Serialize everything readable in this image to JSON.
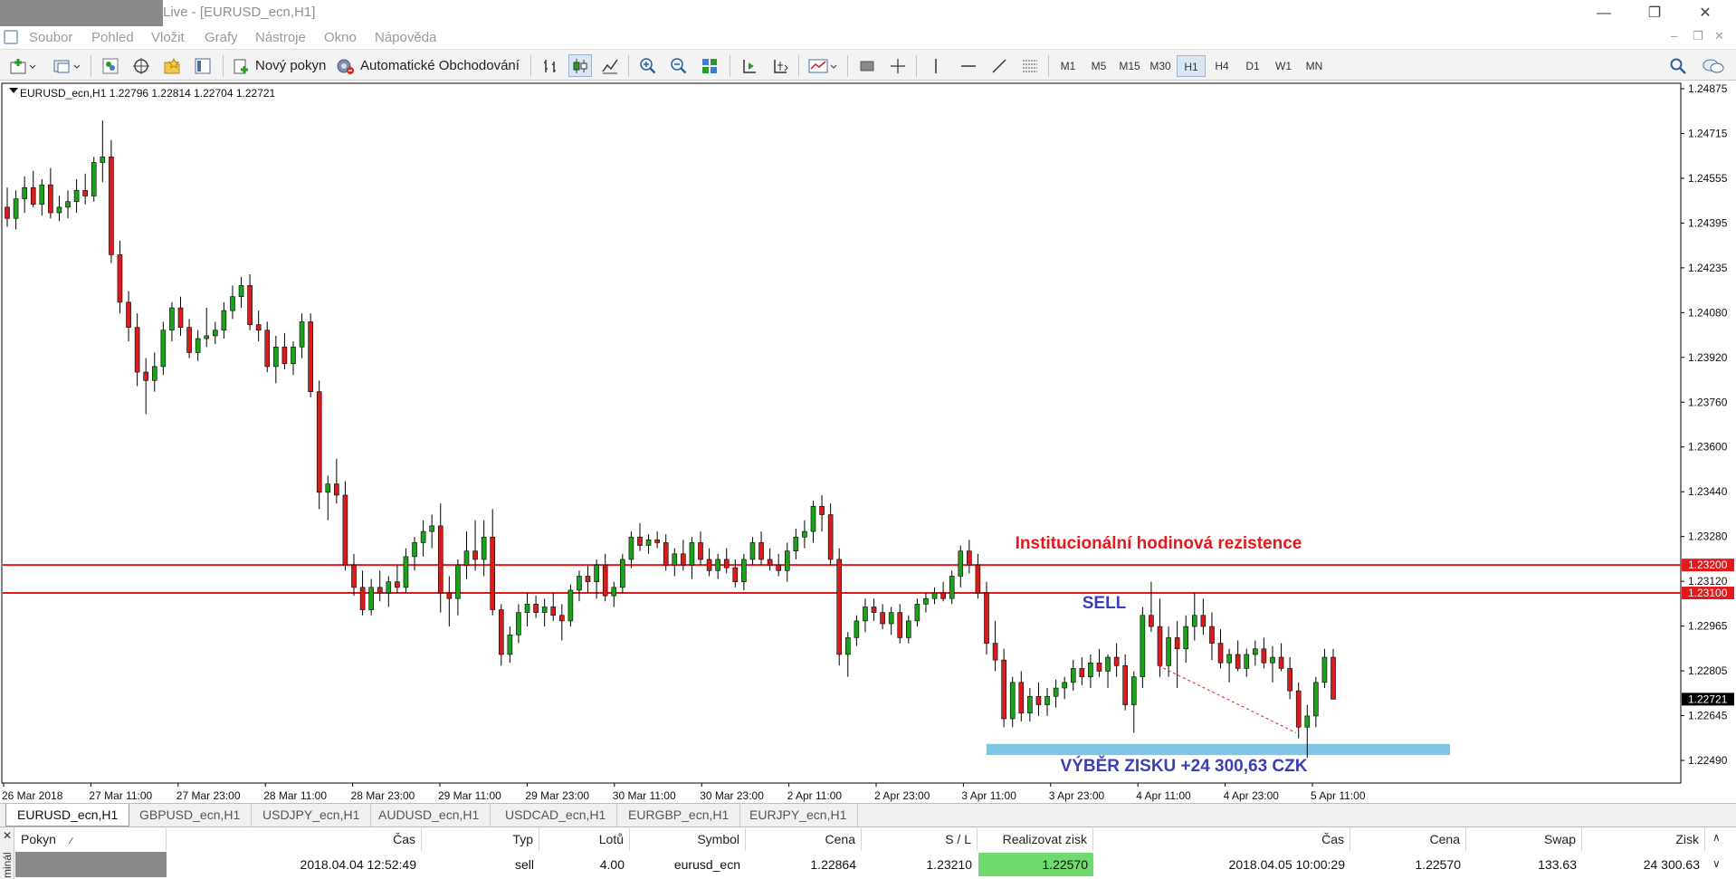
{
  "window": {
    "title": "Live - [EURUSD_ecn,H1]",
    "minimize_icon": "minimize-icon",
    "restore_icon": "restore-icon",
    "close_icon": "close-icon"
  },
  "menu": {
    "items": [
      "Soubor",
      "Pohled",
      "Vložit",
      "Grafy",
      "Nástroje",
      "Okno",
      "Nápověda"
    ]
  },
  "toolbar": {
    "new_order_label": "Nový pokyn",
    "auto_trading_label": "Automatické Obchodování",
    "timeframes": [
      "M1",
      "M5",
      "M15",
      "M30",
      "H1",
      "H4",
      "D1",
      "W1",
      "MN"
    ],
    "active_timeframe": "H1"
  },
  "chart": {
    "header": "EURUSD_ecn,H1  1.22796 1.22814 1.22704 1.22721",
    "resistance_label": "Institucionální hodinová rezistence",
    "sell_label": "SELL",
    "profit_label": "VÝBĚR ZISKU +24 300,63 CZK",
    "colors": {
      "bull": "#1aa31a",
      "bear": "#d81c1c",
      "level": "#e3191d",
      "zone": "#7fc6e6",
      "annot": "#3a3fb5"
    }
  },
  "chart_data": {
    "type": "candlestick",
    "symbol": "EURUSD_ecn",
    "timeframe": "H1",
    "y_ticks": [
      "1.24875",
      "1.24715",
      "1.24555",
      "1.24395",
      "1.24235",
      "1.24080",
      "1.23920",
      "1.23760",
      "1.23600",
      "1.23440",
      "1.23280",
      "1.23120",
      "1.22965",
      "1.22805",
      "1.22645",
      "1.22490"
    ],
    "ylim": [
      1.2242,
      1.2492
    ],
    "x_ticks": [
      "26 Mar 2018",
      "27 Mar 11:00",
      "27 Mar 23:00",
      "28 Mar 11:00",
      "28 Mar 23:00",
      "29 Mar 11:00",
      "29 Mar 23:00",
      "30 Mar 11:00",
      "30 Mar 23:00",
      "2 Apr 11:00",
      "2 Apr 23:00",
      "3 Apr 11:00",
      "3 Apr 23:00",
      "4 Apr 11:00",
      "4 Apr 23:00",
      "5 Apr 11:00"
    ],
    "levels": [
      {
        "price": 1.232,
        "label": "1.23200"
      },
      {
        "price": 1.231,
        "label": "1.23100"
      }
    ],
    "current_price": "1.22721",
    "profit_zone": [
      1.2252,
      1.2256
    ],
    "trend_line": {
      "from": 1.2284,
      "to": 1.226
    },
    "ohlc": [
      [
        1.2448,
        1.2455,
        1.2441,
        1.2444
      ],
      [
        1.2444,
        1.2454,
        1.244,
        1.2451
      ],
      [
        1.2451,
        1.2459,
        1.2446,
        1.2455
      ],
      [
        1.2455,
        1.2461,
        1.2448,
        1.2449
      ],
      [
        1.2449,
        1.2458,
        1.2445,
        1.2456
      ],
      [
        1.2456,
        1.2462,
        1.2444,
        1.2446
      ],
      [
        1.2446,
        1.2452,
        1.2443,
        1.2448
      ],
      [
        1.2448,
        1.2454,
        1.2444,
        1.245
      ],
      [
        1.245,
        1.2458,
        1.2446,
        1.2454
      ],
      [
        1.2454,
        1.246,
        1.2449,
        1.2452
      ],
      [
        1.2452,
        1.2466,
        1.245,
        1.2464
      ],
      [
        1.2464,
        1.2479,
        1.2457,
        1.2466
      ],
      [
        1.2466,
        1.2472,
        1.2428,
        1.2431
      ],
      [
        1.2431,
        1.2436,
        1.241,
        1.2414
      ],
      [
        1.2414,
        1.2418,
        1.24,
        1.2405
      ],
      [
        1.2405,
        1.241,
        1.2384,
        1.2389
      ],
      [
        1.2389,
        1.2394,
        1.2374,
        1.2386
      ],
      [
        1.2386,
        1.2396,
        1.2382,
        1.2391
      ],
      [
        1.2391,
        1.2407,
        1.2388,
        1.2404
      ],
      [
        1.2404,
        1.2414,
        1.24,
        1.2412
      ],
      [
        1.2412,
        1.2416,
        1.2402,
        1.2405
      ],
      [
        1.2405,
        1.2408,
        1.2394,
        1.2396
      ],
      [
        1.2396,
        1.2404,
        1.2393,
        1.2401
      ],
      [
        1.2401,
        1.2412,
        1.2398,
        1.2402
      ],
      [
        1.2402,
        1.2407,
        1.2399,
        1.2404
      ],
      [
        1.2404,
        1.2414,
        1.2401,
        1.2411
      ],
      [
        1.2411,
        1.242,
        1.2408,
        1.2416
      ],
      [
        1.2416,
        1.2423,
        1.2412,
        1.242
      ],
      [
        1.242,
        1.2424,
        1.2404,
        1.2406
      ],
      [
        1.2406,
        1.2411,
        1.24,
        1.2404
      ],
      [
        1.2404,
        1.2407,
        1.2389,
        1.2391
      ],
      [
        1.2391,
        1.2402,
        1.2385,
        1.2398
      ],
      [
        1.2398,
        1.2403,
        1.239,
        1.2392
      ],
      [
        1.2392,
        1.24,
        1.2388,
        1.2398
      ],
      [
        1.2398,
        1.241,
        1.2394,
        1.2407
      ],
      [
        1.2407,
        1.241,
        1.238,
        1.2382
      ],
      [
        1.2382,
        1.2386,
        1.234,
        1.2346
      ],
      [
        1.2346,
        1.2352,
        1.2336,
        1.2349
      ],
      [
        1.2349,
        1.2358,
        1.2342,
        1.2345
      ],
      [
        1.2345,
        1.235,
        1.2318,
        1.232
      ],
      [
        1.232,
        1.2324,
        1.2309,
        1.2312
      ],
      [
        1.2312,
        1.2318,
        1.2302,
        1.2304
      ],
      [
        1.2304,
        1.2315,
        1.2302,
        1.2312
      ],
      [
        1.2312,
        1.2318,
        1.2307,
        1.231
      ],
      [
        1.231,
        1.2316,
        1.2305,
        1.2314
      ],
      [
        1.2314,
        1.232,
        1.231,
        1.2312
      ],
      [
        1.2312,
        1.2326,
        1.231,
        1.2323
      ],
      [
        1.2323,
        1.233,
        1.2318,
        1.2328
      ],
      [
        1.2328,
        1.2336,
        1.2323,
        1.2332
      ],
      [
        1.2332,
        1.2338,
        1.2326,
        1.2334
      ],
      [
        1.2334,
        1.2342,
        1.2303,
        1.231
      ],
      [
        1.231,
        1.2316,
        1.2298,
        1.2308
      ],
      [
        1.2308,
        1.2322,
        1.2302,
        1.232
      ],
      [
        1.232,
        1.2332,
        1.2315,
        1.2325
      ],
      [
        1.2325,
        1.2336,
        1.2318,
        1.2322
      ],
      [
        1.2322,
        1.2336,
        1.2316,
        1.233
      ],
      [
        1.233,
        1.234,
        1.2302,
        1.2304
      ],
      [
        1.2304,
        1.2306,
        1.2284,
        1.2288
      ],
      [
        1.2288,
        1.2298,
        1.2285,
        1.2295
      ],
      [
        1.2295,
        1.2306,
        1.2292,
        1.2303
      ],
      [
        1.2303,
        1.231,
        1.2298,
        1.2306
      ],
      [
        1.2306,
        1.2309,
        1.2301,
        1.2303
      ],
      [
        1.2303,
        1.2308,
        1.2298,
        1.2305
      ],
      [
        1.2305,
        1.231,
        1.23,
        1.2302
      ],
      [
        1.2302,
        1.2306,
        1.2293,
        1.23
      ],
      [
        1.23,
        1.2313,
        1.2298,
        1.2311
      ],
      [
        1.2311,
        1.2318,
        1.2307,
        1.2316
      ],
      [
        1.2316,
        1.232,
        1.231,
        1.2314
      ],
      [
        1.2314,
        1.2322,
        1.2308,
        1.232
      ],
      [
        1.232,
        1.2324,
        1.2307,
        1.2309
      ],
      [
        1.2309,
        1.2314,
        1.2305,
        1.2312
      ],
      [
        1.2312,
        1.2324,
        1.231,
        1.2322
      ],
      [
        1.2322,
        1.2332,
        1.2319,
        1.233
      ],
      [
        1.233,
        1.2335,
        1.2325,
        1.2327
      ],
      [
        1.2327,
        1.2331,
        1.2324,
        1.2329
      ],
      [
        1.2329,
        1.2332,
        1.2326,
        1.2328
      ],
      [
        1.2328,
        1.2331,
        1.2318,
        1.232
      ],
      [
        1.232,
        1.2326,
        1.2316,
        1.2324
      ],
      [
        1.2324,
        1.2329,
        1.2318,
        1.232
      ],
      [
        1.232,
        1.233,
        1.2315,
        1.2328
      ],
      [
        1.2328,
        1.2332,
        1.232,
        1.2322
      ],
      [
        1.2322,
        1.2326,
        1.2316,
        1.2318
      ],
      [
        1.2318,
        1.2324,
        1.2315,
        1.2322
      ],
      [
        1.2322,
        1.2326,
        1.2317,
        1.2319
      ],
      [
        1.2319,
        1.2322,
        1.2312,
        1.2314
      ],
      [
        1.2314,
        1.2324,
        1.2311,
        1.2322
      ],
      [
        1.2322,
        1.233,
        1.232,
        1.2328
      ],
      [
        1.2328,
        1.2332,
        1.232,
        1.2322
      ],
      [
        1.2322,
        1.2326,
        1.2318,
        1.232
      ],
      [
        1.232,
        1.2324,
        1.2316,
        1.2318
      ],
      [
        1.2318,
        1.2328,
        1.2314,
        1.2325
      ],
      [
        1.2325,
        1.2333,
        1.2322,
        1.233
      ],
      [
        1.233,
        1.2336,
        1.2326,
        1.2332
      ],
      [
        1.2332,
        1.2343,
        1.2328,
        1.2341
      ],
      [
        1.2341,
        1.2345,
        1.2332,
        1.2338
      ],
      [
        1.2338,
        1.2342,
        1.232,
        1.2322
      ],
      [
        1.2322,
        1.2326,
        1.2284,
        1.2288
      ],
      [
        1.2288,
        1.2296,
        1.228,
        1.2294
      ],
      [
        1.2294,
        1.2302,
        1.2291,
        1.23
      ],
      [
        1.23,
        1.2308,
        1.2296,
        1.2305
      ],
      [
        1.2305,
        1.2308,
        1.23,
        1.2303
      ],
      [
        1.2303,
        1.2306,
        1.2297,
        1.2299
      ],
      [
        1.2299,
        1.2305,
        1.2295,
        1.2303
      ],
      [
        1.2303,
        1.2306,
        1.2292,
        1.2294
      ],
      [
        1.2294,
        1.2302,
        1.2292,
        1.23
      ],
      [
        1.23,
        1.2308,
        1.2298,
        1.2306
      ],
      [
        1.2306,
        1.231,
        1.2303,
        1.2308
      ],
      [
        1.2308,
        1.2312,
        1.2306,
        1.231
      ],
      [
        1.231,
        1.2314,
        1.2307,
        1.2308
      ],
      [
        1.2308,
        1.2318,
        1.2306,
        1.2316
      ],
      [
        1.2316,
        1.2327,
        1.2312,
        1.2325
      ],
      [
        1.2325,
        1.2329,
        1.2317,
        1.232
      ],
      [
        1.232,
        1.2324,
        1.2308,
        1.231
      ],
      [
        1.231,
        1.2314,
        1.2288,
        1.2292
      ],
      [
        1.2292,
        1.23,
        1.2282,
        1.2286
      ],
      [
        1.2286,
        1.229,
        1.2262,
        1.2265
      ],
      [
        1.2265,
        1.228,
        1.2262,
        1.2278
      ],
      [
        1.2278,
        1.2282,
        1.2264,
        1.2267
      ],
      [
        1.2267,
        1.2276,
        1.2264,
        1.2273
      ],
      [
        1.2273,
        1.2278,
        1.2266,
        1.227
      ],
      [
        1.227,
        1.2276,
        1.2266,
        1.2273
      ],
      [
        1.2273,
        1.2279,
        1.2269,
        1.2276
      ],
      [
        1.2276,
        1.228,
        1.2272,
        1.2278
      ],
      [
        1.2278,
        1.2286,
        1.2275,
        1.2283
      ],
      [
        1.2283,
        1.2287,
        1.2277,
        1.228
      ],
      [
        1.228,
        1.2288,
        1.2276,
        1.2285
      ],
      [
        1.2285,
        1.229,
        1.228,
        1.2282
      ],
      [
        1.2282,
        1.2288,
        1.2276,
        1.2287
      ],
      [
        1.2287,
        1.2292,
        1.228,
        1.2284
      ],
      [
        1.2284,
        1.2288,
        1.2268,
        1.227
      ],
      [
        1.227,
        1.2282,
        1.226,
        1.228
      ],
      [
        1.228,
        1.2305,
        1.2276,
        1.2302
      ],
      [
        1.2302,
        1.2314,
        1.2296,
        1.2298
      ],
      [
        1.2298,
        1.2308,
        1.228,
        1.2284
      ],
      [
        1.2284,
        1.2298,
        1.228,
        1.2294
      ],
      [
        1.2294,
        1.23,
        1.2276,
        1.229
      ],
      [
        1.229,
        1.2302,
        1.2285,
        1.2298
      ],
      [
        1.2298,
        1.231,
        1.2293,
        1.2302
      ],
      [
        1.2302,
        1.2308,
        1.2295,
        1.2298
      ],
      [
        1.2298,
        1.2303,
        1.2286,
        1.2292
      ],
      [
        1.2292,
        1.2297,
        1.2283,
        1.2285
      ],
      [
        1.2285,
        1.229,
        1.2278,
        1.2288
      ],
      [
        1.2288,
        1.2293,
        1.2282,
        1.2283
      ],
      [
        1.2283,
        1.229,
        1.228,
        1.2288
      ],
      [
        1.2288,
        1.2293,
        1.2284,
        1.229
      ],
      [
        1.229,
        1.2294,
        1.2283,
        1.2285
      ],
      [
        1.2285,
        1.2291,
        1.2278,
        1.2287
      ],
      [
        1.2287,
        1.2292,
        1.2282,
        1.2283
      ],
      [
        1.2283,
        1.2287,
        1.2272,
        1.2275
      ],
      [
        1.2275,
        1.2278,
        1.2258,
        1.2262
      ],
      [
        1.2262,
        1.227,
        1.2251,
        1.2266
      ],
      [
        1.2266,
        1.228,
        1.2262,
        1.2278
      ],
      [
        1.2278,
        1.229,
        1.2276,
        1.2287
      ],
      [
        1.2287,
        1.229,
        1.2275,
        1.2272
      ]
    ]
  },
  "tabs": [
    "EURUSD_ecn,H1",
    "GBPUSD_ecn,H1",
    "USDJPY_ecn,H1",
    "AUDUSD_ecn,H1",
    "USDCAD_ecn,H1",
    "EURGBP_ecn,H1",
    "EURJPY_ecn,H1"
  ],
  "terminal": {
    "side_label": "minál",
    "headers": {
      "order": "Pokyn",
      "time": "Čas",
      "type": "Typ",
      "lots": "Lotů",
      "symbol": "Symbol",
      "price": "Cena",
      "sl": "S / L",
      "tp": "Realizovat zisk",
      "close_time": "Čas",
      "close_price": "Cena",
      "swap": "Swap",
      "profit": "Zisk"
    },
    "row": {
      "time": "2018.04.04 12:52:49",
      "type": "sell",
      "lots": "4.00",
      "symbol": "eurusd_ecn",
      "price": "1.22864",
      "sl": "1.23210",
      "tp": "1.22570",
      "close_time": "2018.04.05 10:00:29",
      "close_price": "1.22570",
      "swap": "133.63",
      "profit": "24 300.63"
    }
  }
}
